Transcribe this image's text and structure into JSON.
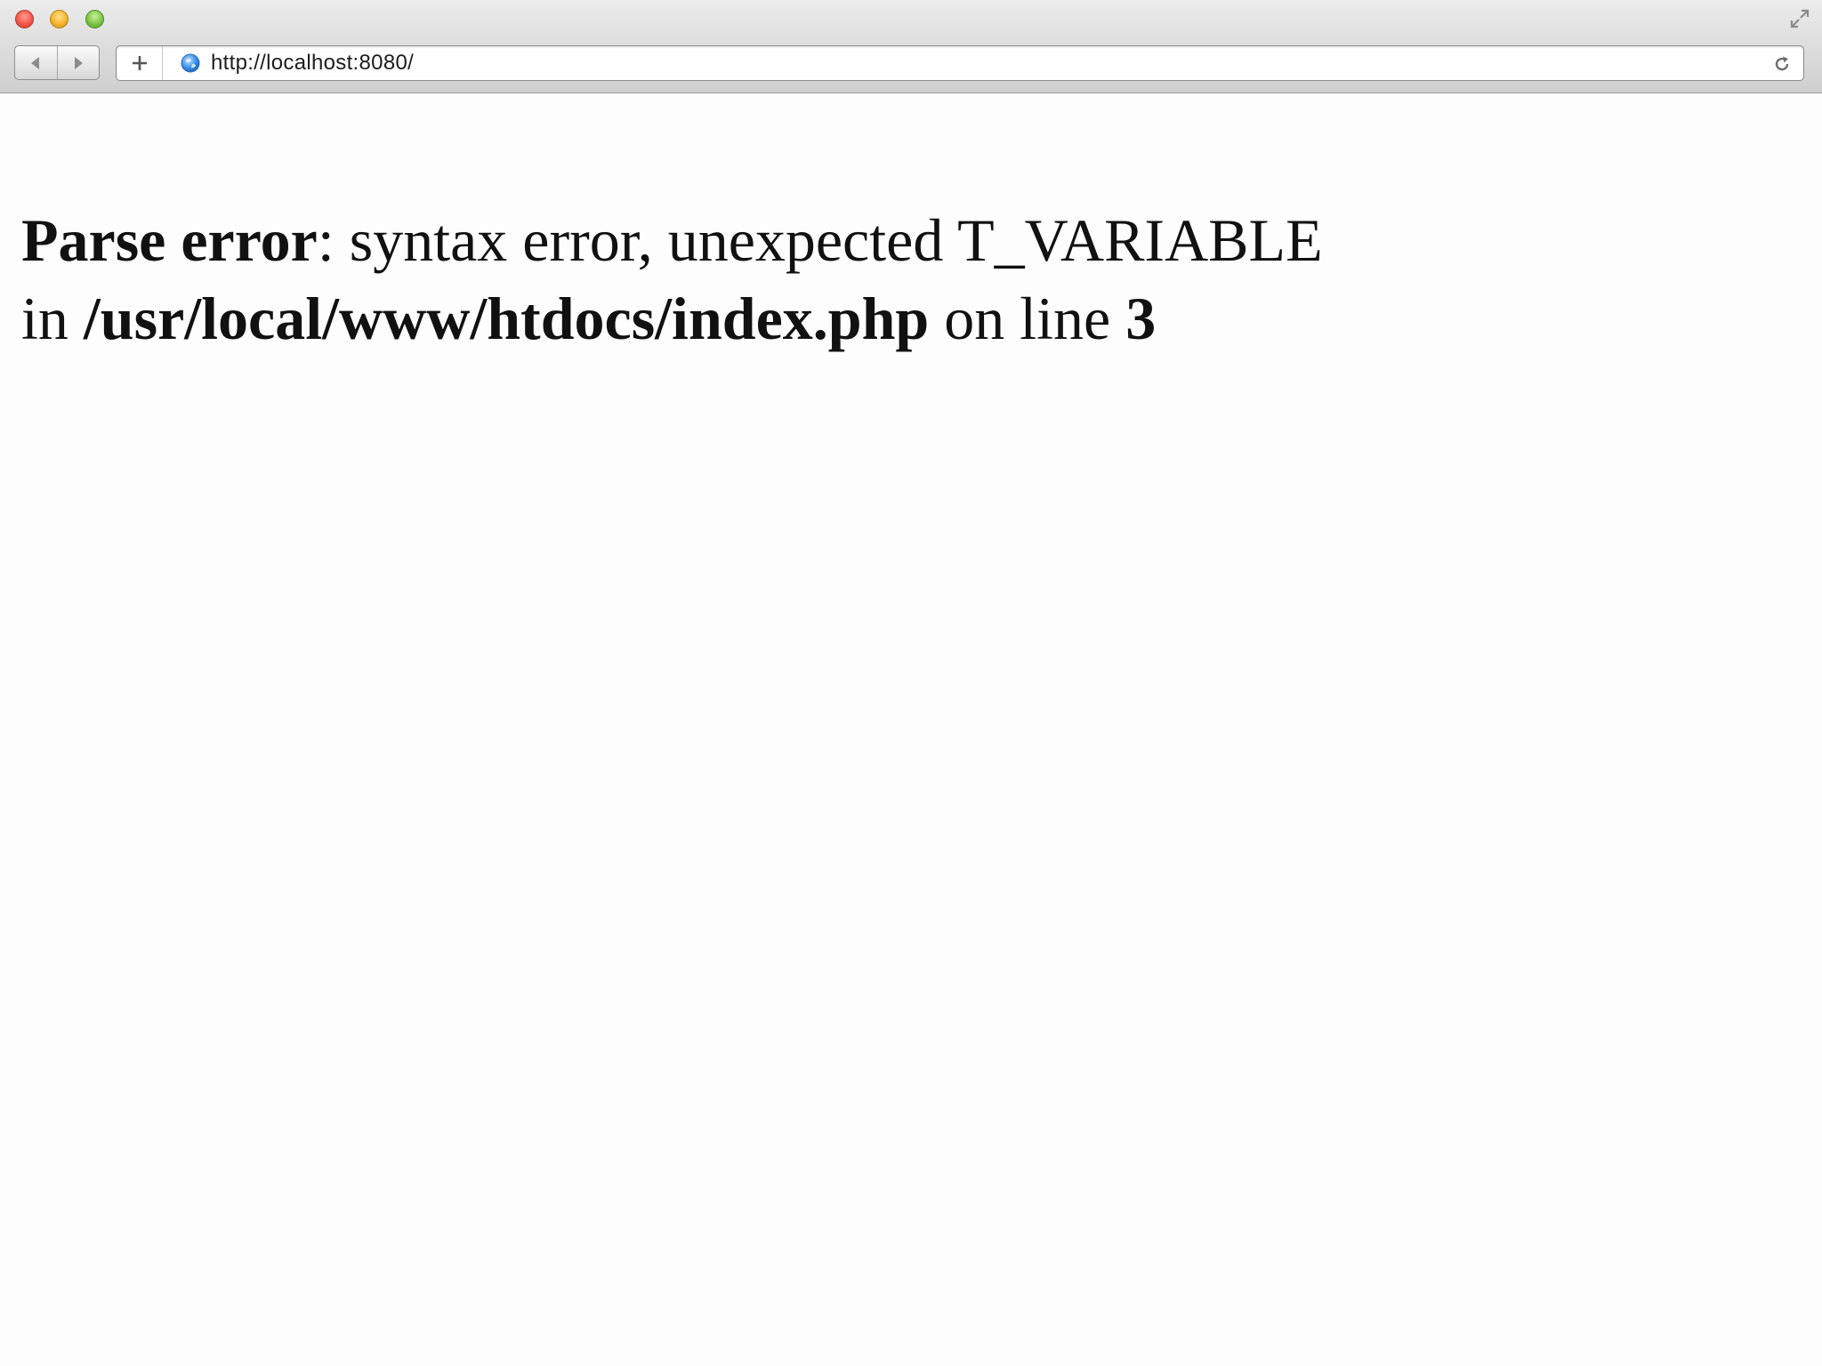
{
  "browser": {
    "url": "http://localhost:8080/",
    "colors": {
      "close": "#f4574b",
      "minimize": "#f6b62e",
      "zoom": "#7cc645",
      "globe": "#3a8ee6"
    },
    "icons": [
      "back-icon",
      "forward-icon",
      "add-icon",
      "globe-icon",
      "reload-icon",
      "fullscreen-icon"
    ]
  },
  "error": {
    "heading": "Parse error",
    "message": ": syntax error, unexpected T_VARIABLE",
    "in_text": "in ",
    "file": "/usr/local/www/htdocs/index.php",
    "line_text": " on line ",
    "line_number": "3"
  }
}
